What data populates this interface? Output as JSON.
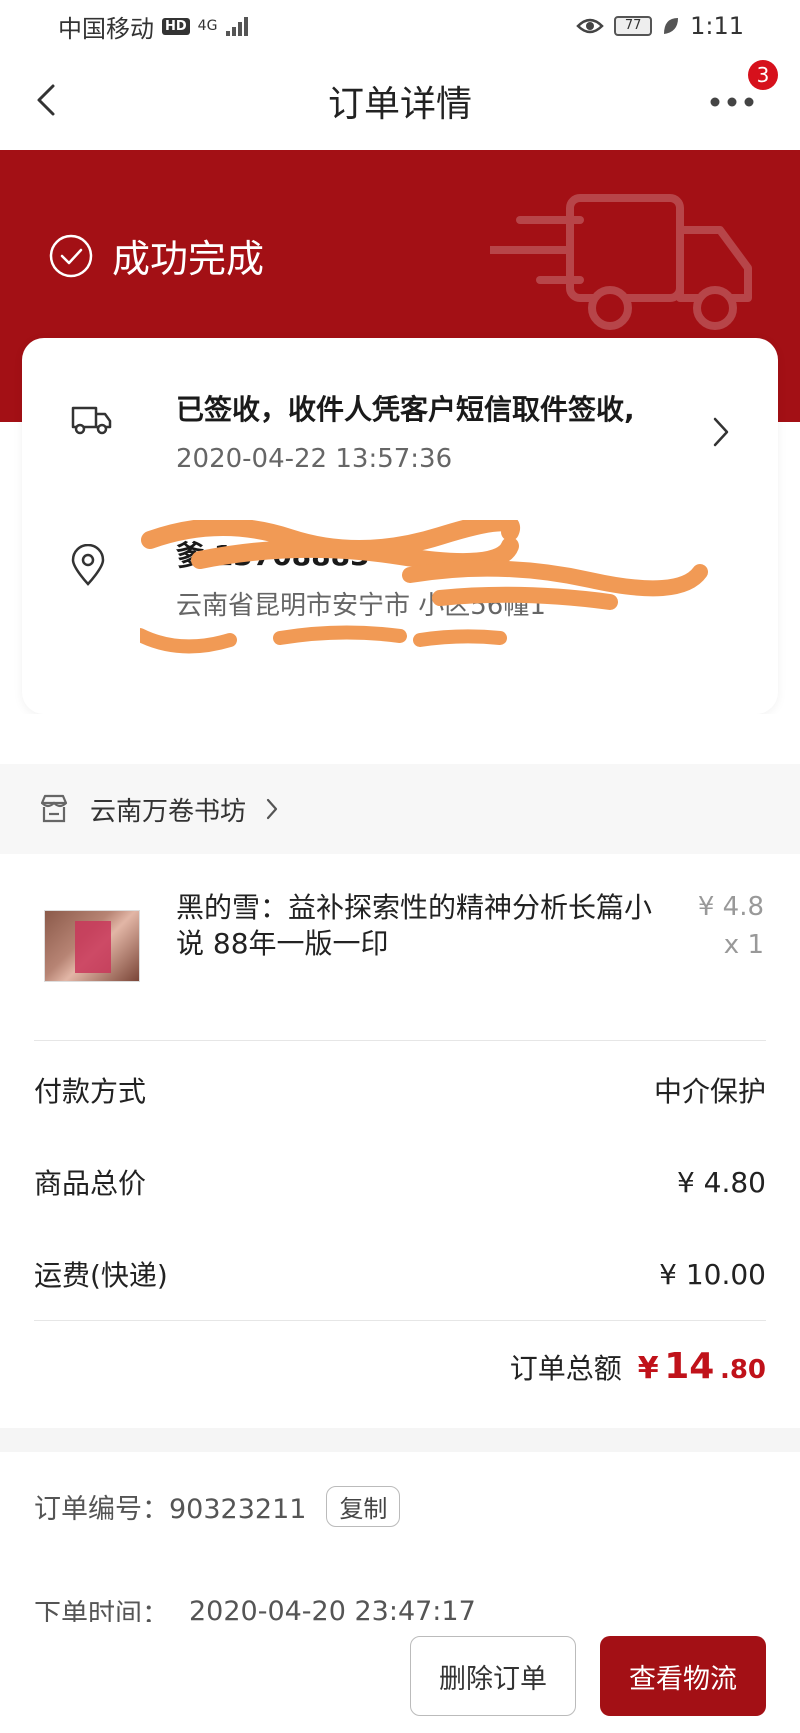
{
  "status_bar": {
    "carrier": "中国移动",
    "hd": "HD",
    "network": "4G",
    "battery": "77",
    "time": "1:11"
  },
  "header": {
    "title": "订单详情",
    "notification_count": "3"
  },
  "banner": {
    "status": "成功完成"
  },
  "logistics": {
    "latest": "已签收，收件人凭客户短信取件签收,",
    "time": "2020-04-22 13:57:36"
  },
  "address": {
    "recipient": "爹 13708883",
    "detail": "云南省昆明市安宁市 小区56幢1"
  },
  "shop": {
    "name": "云南万卷书坊"
  },
  "product": {
    "title": "黑的雪：益补探索性的精神分析长篇小说 88年一版一印",
    "price": "¥ 4.8",
    "qty": "x 1"
  },
  "payment": {
    "method_label": "付款方式",
    "method_value": "中介保护",
    "subtotal_label": "商品总价",
    "subtotal_value": "¥ 4.80",
    "shipping_label": "运费(快递)",
    "shipping_value": "¥ 10.00",
    "total_label": "订单总额",
    "total_symbol": "¥",
    "total_int": "14",
    "total_dec": ".80"
  },
  "order": {
    "number_label": "订单编号：",
    "number_value": "90323211",
    "copy_label": "复制",
    "time_label": "下单时间：",
    "time_value": "2020-04-20 23:47:17"
  },
  "actions": {
    "delete": "删除订单",
    "view": "查看物流"
  },
  "colors": {
    "brand_red": "#a31015",
    "price_red": "#c0121a",
    "badge_red": "#d6111c"
  }
}
